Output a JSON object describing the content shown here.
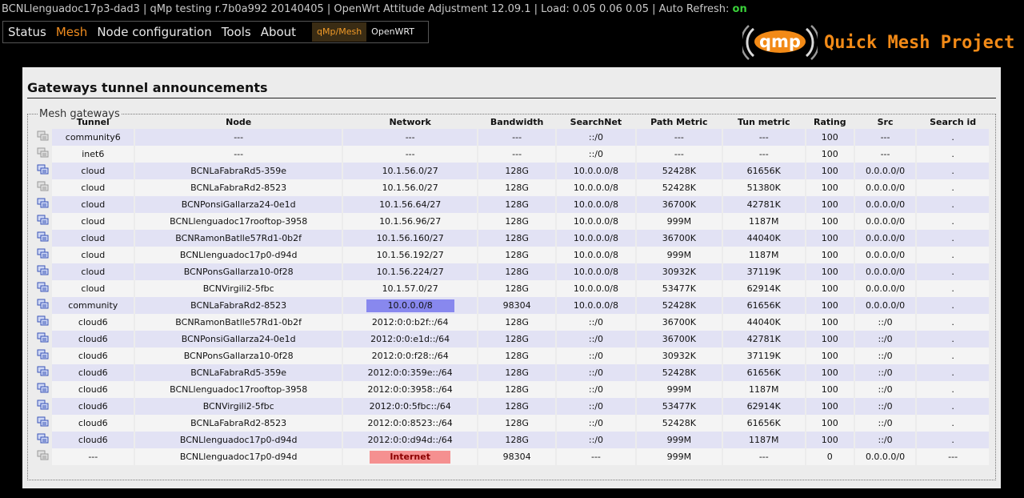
{
  "status": {
    "text": "BCNLlenguadoc17p3-dad3 | qMp testing r.7b0a992 20140405 | OpenWrt Attitude Adjustment 12.09.1 | Load: 0.05 0.06 0.05 | Auto Refresh: ",
    "refresh_state": "on"
  },
  "menu": [
    {
      "label": "Status"
    },
    {
      "label": "Mesh",
      "active": true
    },
    {
      "label": "Node configuration"
    },
    {
      "label": "Tools"
    },
    {
      "label": "About"
    }
  ],
  "switcher": {
    "qmp": "qMp/Mesh",
    "openwrt": "OpenWRT"
  },
  "logo": {
    "mark": "qmp",
    "title": "Quick Mesh Project"
  },
  "page": {
    "title": "Gateways tunnel announcements",
    "fieldset": "Mesh gateways"
  },
  "colors": {
    "accent": "#f28a17",
    "net_highlight": "#8888ee",
    "inet_highlight": "#f59090"
  },
  "table": {
    "columns": [
      "Tunnel",
      "Node",
      "Network",
      "Bandwidth",
      "SearchNet",
      "Path Metric",
      "Tun metric",
      "Rating",
      "Src",
      "Search id"
    ],
    "rows": [
      {
        "icon": "host-gray",
        "cells": [
          "community6",
          "---",
          "---",
          "---",
          "::/0",
          "---",
          "---",
          "100",
          "---",
          "."
        ]
      },
      {
        "icon": "host-gray",
        "cells": [
          "inet6",
          "---",
          "---",
          "---",
          "::/0",
          "---",
          "---",
          "100",
          "---",
          "."
        ]
      },
      {
        "icon": "host-blue",
        "cells": [
          "cloud",
          "BCNLaFabraRd5-359e",
          "10.1.56.0/27",
          "128G",
          "10.0.0.0/8",
          "52428K",
          "61656K",
          "100",
          "0.0.0.0/0",
          "."
        ]
      },
      {
        "icon": "host-gray",
        "cells": [
          "cloud",
          "BCNLaFabraRd2-8523",
          "10.1.56.0/27",
          "128G",
          "10.0.0.0/8",
          "52428K",
          "51380K",
          "100",
          "0.0.0.0/0",
          "."
        ]
      },
      {
        "icon": "host-blue",
        "cells": [
          "cloud",
          "BCNPonsiGallarza24-0e1d",
          "10.1.56.64/27",
          "128G",
          "10.0.0.0/8",
          "36700K",
          "42781K",
          "100",
          "0.0.0.0/0",
          "."
        ]
      },
      {
        "icon": "host-blue",
        "cells": [
          "cloud",
          "BCNLlenguadoc17rooftop-3958",
          "10.1.56.96/27",
          "128G",
          "10.0.0.0/8",
          "999M",
          "1187M",
          "100",
          "0.0.0.0/0",
          "."
        ]
      },
      {
        "icon": "host-blue",
        "cells": [
          "cloud",
          "BCNRamonBatlle57Rd1-0b2f",
          "10.1.56.160/27",
          "128G",
          "10.0.0.0/8",
          "36700K",
          "44040K",
          "100",
          "0.0.0.0/0",
          "."
        ]
      },
      {
        "icon": "host-blue",
        "cells": [
          "cloud",
          "BCNLlenguadoc17p0-d94d",
          "10.1.56.192/27",
          "128G",
          "10.0.0.0/8",
          "999M",
          "1187M",
          "100",
          "0.0.0.0/0",
          "."
        ]
      },
      {
        "icon": "host-blue",
        "cells": [
          "cloud",
          "BCNPonsGallarza10-0f28",
          "10.1.56.224/27",
          "128G",
          "10.0.0.0/8",
          "30932K",
          "37119K",
          "100",
          "0.0.0.0/0",
          "."
        ]
      },
      {
        "icon": "host-blue",
        "cells": [
          "cloud",
          "BCNVirgili2-5fbc",
          "10.1.57.0/27",
          "128G",
          "10.0.0.0/8",
          "53477K",
          "62914K",
          "100",
          "0.0.0.0/0",
          "."
        ]
      },
      {
        "icon": "host-blue",
        "highlight": "net",
        "cells": [
          "community",
          "BCNLaFabraRd2-8523",
          "10.0.0.0/8",
          "98304",
          "10.0.0.0/8",
          "52428K",
          "61656K",
          "100",
          "0.0.0.0/0",
          "."
        ]
      },
      {
        "icon": "host-blue",
        "cells": [
          "cloud6",
          "BCNRamonBatlle57Rd1-0b2f",
          "2012:0:0:b2f::/64",
          "128G",
          "::/0",
          "36700K",
          "44040K",
          "100",
          "::/0",
          "."
        ]
      },
      {
        "icon": "host-blue",
        "cells": [
          "cloud6",
          "BCNPonsiGallarza24-0e1d",
          "2012:0:0:e1d::/64",
          "128G",
          "::/0",
          "36700K",
          "42781K",
          "100",
          "::/0",
          "."
        ]
      },
      {
        "icon": "host-blue",
        "cells": [
          "cloud6",
          "BCNPonsGallarza10-0f28",
          "2012:0:0:f28::/64",
          "128G",
          "::/0",
          "30932K",
          "37119K",
          "100",
          "::/0",
          "."
        ]
      },
      {
        "icon": "host-blue",
        "cells": [
          "cloud6",
          "BCNLaFabraRd5-359e",
          "2012:0:0:359e::/64",
          "128G",
          "::/0",
          "52428K",
          "61656K",
          "100",
          "::/0",
          "."
        ]
      },
      {
        "icon": "host-blue",
        "cells": [
          "cloud6",
          "BCNLlenguadoc17rooftop-3958",
          "2012:0:0:3958::/64",
          "128G",
          "::/0",
          "999M",
          "1187M",
          "100",
          "::/0",
          "."
        ]
      },
      {
        "icon": "host-blue",
        "cells": [
          "cloud6",
          "BCNVirgili2-5fbc",
          "2012:0:0:5fbc::/64",
          "128G",
          "::/0",
          "53477K",
          "62914K",
          "100",
          "::/0",
          "."
        ]
      },
      {
        "icon": "host-blue",
        "cells": [
          "cloud6",
          "BCNLaFabraRd2-8523",
          "2012:0:0:8523::/64",
          "128G",
          "::/0",
          "52428K",
          "61656K",
          "100",
          "::/0",
          "."
        ]
      },
      {
        "icon": "host-blue",
        "cells": [
          "cloud6",
          "BCNLlenguadoc17p0-d94d",
          "2012:0:0:d94d::/64",
          "128G",
          "::/0",
          "999M",
          "1187M",
          "100",
          "::/0",
          "."
        ]
      },
      {
        "icon": "host-gray",
        "highlight": "inet",
        "cells": [
          "---",
          "BCNLlenguadoc17p0-d94d",
          "Internet",
          "98304",
          "---",
          "999M",
          "---",
          "0",
          "0.0.0.0/0",
          "---"
        ]
      }
    ]
  }
}
